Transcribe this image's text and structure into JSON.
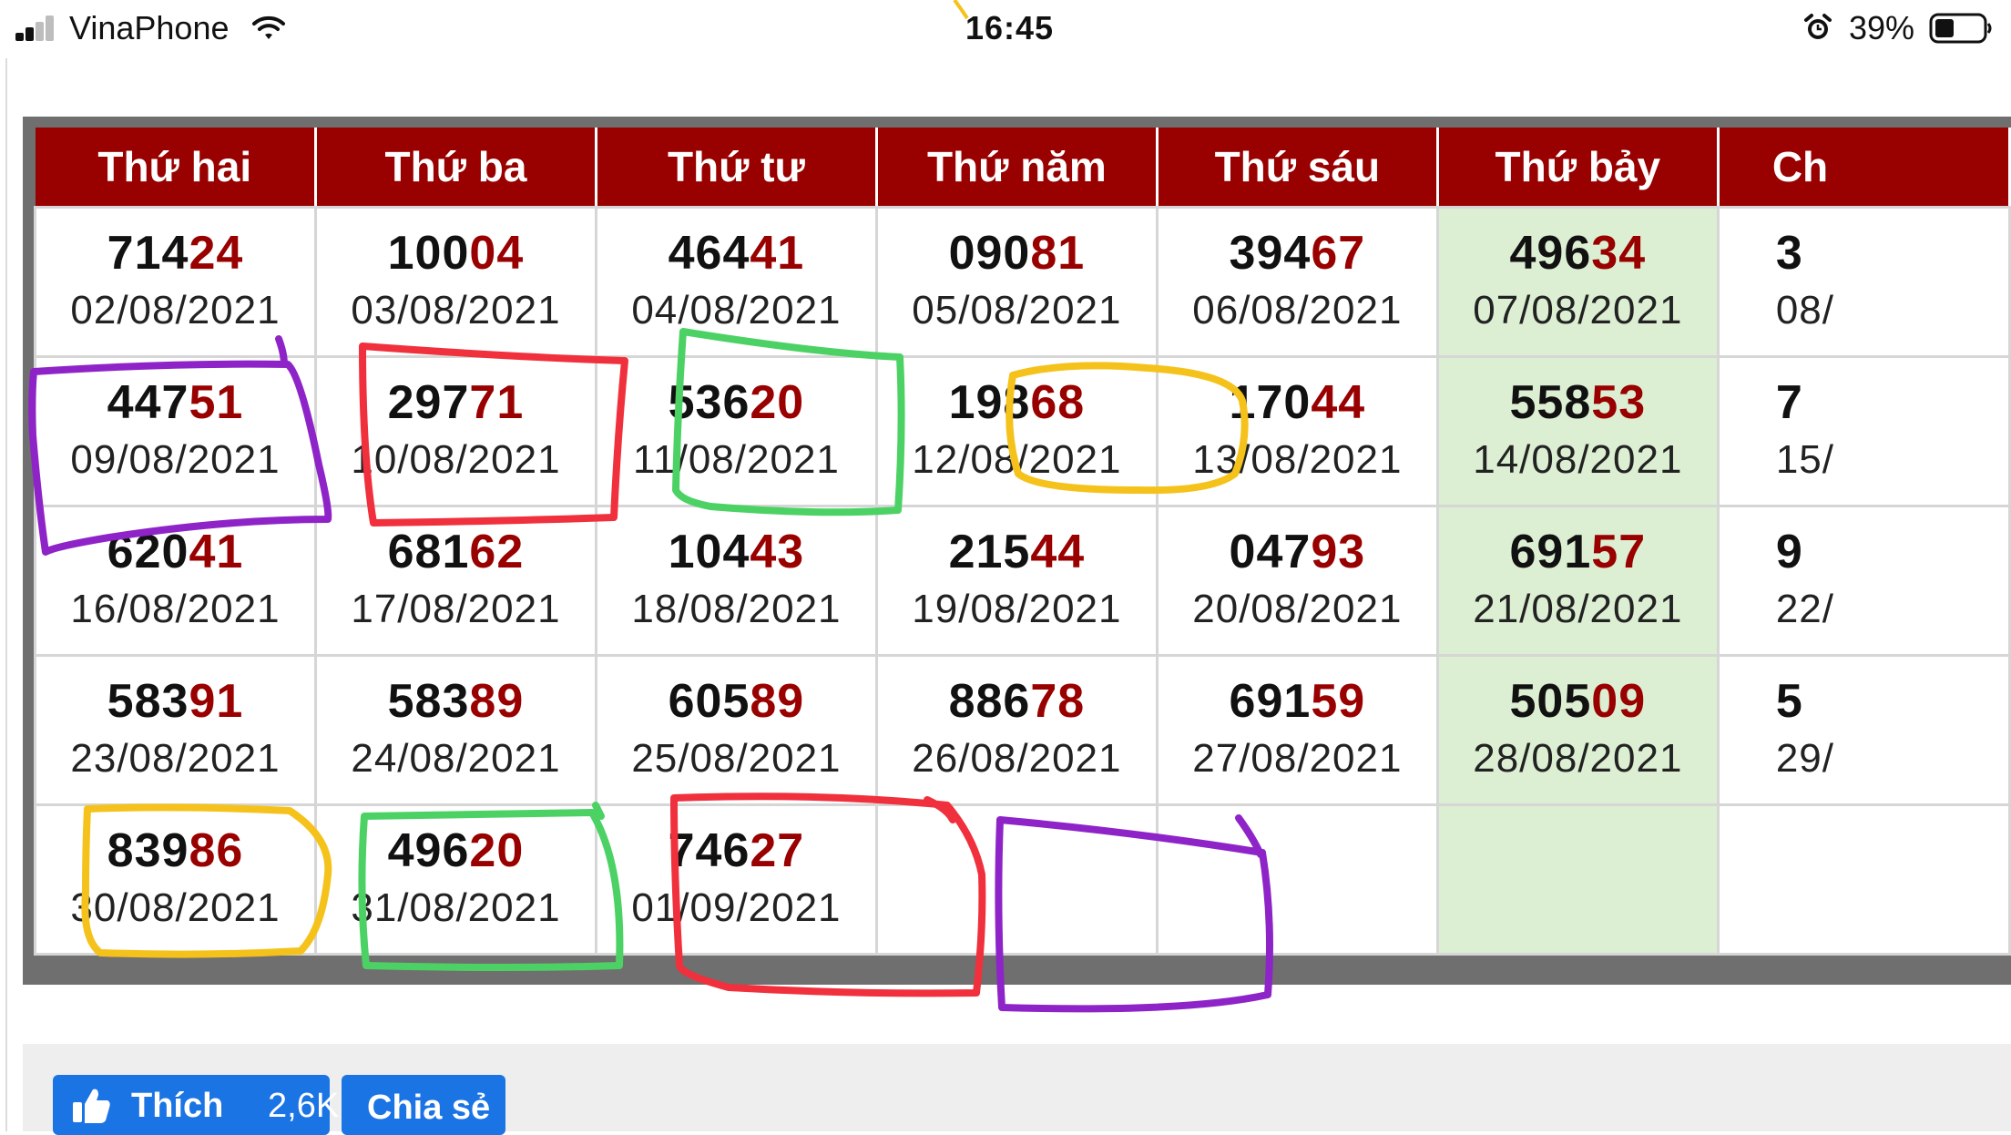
{
  "status_bar": {
    "carrier": "VinaPhone",
    "time": "16:45",
    "battery_percent": "39%",
    "signal_bars": 2,
    "battery_level": 0.39,
    "icons": [
      "signal-icon",
      "wifi-icon",
      "alarm-icon",
      "battery-icon"
    ]
  },
  "calendar": {
    "headers": [
      "Thứ hai",
      "Thứ ba",
      "Thứ tư",
      "Thứ năm",
      "Thứ sáu",
      "Thứ bảy",
      "Ch"
    ],
    "weekend_column": 5,
    "rows": [
      [
        {
          "num_hi": "714",
          "num_lo": "24",
          "date": "02/08/2021"
        },
        {
          "num_hi": "100",
          "num_lo": "04",
          "date": "03/08/2021"
        },
        {
          "num_hi": "464",
          "num_lo": "41",
          "date": "04/08/2021"
        },
        {
          "num_hi": "090",
          "num_lo": "81",
          "date": "05/08/2021"
        },
        {
          "num_hi": "394",
          "num_lo": "67",
          "date": "06/08/2021"
        },
        {
          "num_hi": "496",
          "num_lo": "34",
          "date": "07/08/2021"
        },
        {
          "num_hi": "3",
          "num_lo": "",
          "date": "08/"
        }
      ],
      [
        {
          "num_hi": "447",
          "num_lo": "51",
          "date": "09/08/2021"
        },
        {
          "num_hi": "297",
          "num_lo": "71",
          "date": "10/08/2021"
        },
        {
          "num_hi": "536",
          "num_lo": "20",
          "date": "11/08/2021"
        },
        {
          "num_hi": "198",
          "num_lo": "68",
          "date": "12/08/2021"
        },
        {
          "num_hi": "170",
          "num_lo": "44",
          "date": "13/08/2021"
        },
        {
          "num_hi": "558",
          "num_lo": "53",
          "date": "14/08/2021"
        },
        {
          "num_hi": "7",
          "num_lo": "",
          "date": "15/"
        }
      ],
      [
        {
          "num_hi": "620",
          "num_lo": "41",
          "date": "16/08/2021"
        },
        {
          "num_hi": "681",
          "num_lo": "62",
          "date": "17/08/2021"
        },
        {
          "num_hi": "104",
          "num_lo": "43",
          "date": "18/08/2021"
        },
        {
          "num_hi": "215",
          "num_lo": "44",
          "date": "19/08/2021"
        },
        {
          "num_hi": "047",
          "num_lo": "93",
          "date": "20/08/2021"
        },
        {
          "num_hi": "691",
          "num_lo": "57",
          "date": "21/08/2021"
        },
        {
          "num_hi": "9",
          "num_lo": "",
          "date": "22/"
        }
      ],
      [
        {
          "num_hi": "583",
          "num_lo": "91",
          "date": "23/08/2021"
        },
        {
          "num_hi": "583",
          "num_lo": "89",
          "date": "24/08/2021"
        },
        {
          "num_hi": "605",
          "num_lo": "89",
          "date": "25/08/2021"
        },
        {
          "num_hi": "886",
          "num_lo": "78",
          "date": "26/08/2021"
        },
        {
          "num_hi": "691",
          "num_lo": "59",
          "date": "27/08/2021"
        },
        {
          "num_hi": "505",
          "num_lo": "09",
          "date": "28/08/2021"
        },
        {
          "num_hi": "5",
          "num_lo": "",
          "date": "29/"
        }
      ],
      [
        {
          "num_hi": "839",
          "num_lo": "86",
          "date": "30/08/2021"
        },
        {
          "num_hi": "496",
          "num_lo": "20",
          "date": "31/08/2021"
        },
        {
          "num_hi": "746",
          "num_lo": "27",
          "date": "01/09/2021"
        },
        {
          "num_hi": "",
          "num_lo": "",
          "date": ""
        },
        {
          "num_hi": "",
          "num_lo": "",
          "date": ""
        },
        {
          "num_hi": "",
          "num_lo": "",
          "date": ""
        },
        {
          "num_hi": "",
          "num_lo": "",
          "date": ""
        }
      ]
    ]
  },
  "colors": {
    "header_bg": "#990000",
    "number_accent": "#990000",
    "weekend_bg": "#dcefd3",
    "ink_purple": "#8e24c8",
    "ink_red": "#f0303c",
    "ink_green": "#4cd264",
    "ink_yellow": "#f5c21b",
    "facebook_blue": "#1b74e4"
  },
  "social": {
    "like_label": "Thích",
    "like_count": "2,6K",
    "share_label": "Chia sẻ"
  }
}
